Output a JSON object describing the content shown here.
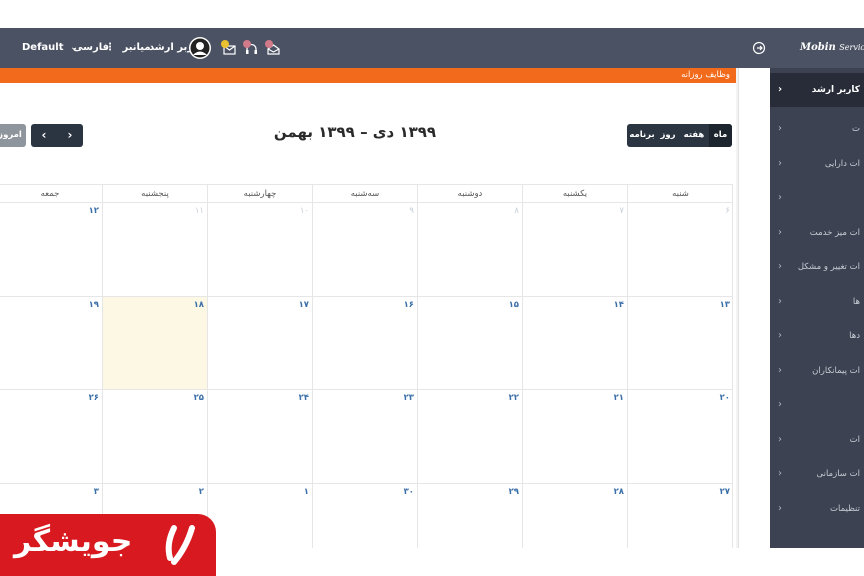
{
  "topbar": {
    "brand_main": "Mobin",
    "brand_sub": "Service De",
    "user_name": "کاربر ارشد",
    "shortcuts": "میانبر",
    "language": "فارسی",
    "theme": "Default"
  },
  "sidebar": {
    "active": {
      "label": "کاربر ارشد"
    },
    "items": [
      {
        "label": "ت"
      },
      {
        "label": "ات دارایی"
      },
      {
        "label": ""
      },
      {
        "label": "ات میز خدمت"
      },
      {
        "label": "ات تغییر و مشکل"
      },
      {
        "label": "ها"
      },
      {
        "label": "دها"
      },
      {
        "label": "ات پیمانکاران"
      },
      {
        "label": ""
      },
      {
        "label": "ات"
      },
      {
        "label": "ات سازمانی"
      },
      {
        "label": "تنظیمات"
      }
    ]
  },
  "content": {
    "section_title": "وظایف روزانه",
    "calendar_title": "۱۳۹۹ دی – ۱۳۹۹ بهمن",
    "views": [
      "ماه",
      "هفته",
      "روز",
      "برنامه"
    ],
    "active_view": "ماه",
    "nav_prev": "‹",
    "nav_next": "›",
    "today_label": "امروز",
    "weekdays": [
      "شنبه",
      "یکشنبه",
      "دوشنبه",
      "سه‌شنبه",
      "چهارشنبه",
      "پنجشنبه",
      "جمعه"
    ],
    "weeks": [
      [
        {
          "d": "۶",
          "other": true
        },
        {
          "d": "۷",
          "other": true
        },
        {
          "d": "۸",
          "other": true
        },
        {
          "d": "۹",
          "other": true
        },
        {
          "d": "۱۰",
          "other": true
        },
        {
          "d": "۱۱",
          "other": true
        },
        {
          "d": "۱۲"
        }
      ],
      [
        {
          "d": "۱۳"
        },
        {
          "d": "۱۴"
        },
        {
          "d": "۱۵"
        },
        {
          "d": "۱۶"
        },
        {
          "d": "۱۷"
        },
        {
          "d": "۱۸",
          "today": true
        },
        {
          "d": "۱۹"
        }
      ],
      [
        {
          "d": "۲۰"
        },
        {
          "d": "۲۱"
        },
        {
          "d": "۲۲"
        },
        {
          "d": "۲۳"
        },
        {
          "d": "۲۴"
        },
        {
          "d": "۲۵"
        },
        {
          "d": "۲۶"
        }
      ],
      [
        {
          "d": "۲۷"
        },
        {
          "d": "۲۸"
        },
        {
          "d": "۲۹"
        },
        {
          "d": "۳۰"
        },
        {
          "d": "۱"
        },
        {
          "d": "۲"
        },
        {
          "d": "۳"
        }
      ]
    ]
  },
  "watermark": {
    "text": "جویشگر"
  },
  "colors": {
    "topbar": "#4b5263",
    "sidebar": "#3c4252",
    "accent": "#f26a1b",
    "today": "#fcf8e3",
    "logo": "#d8191f"
  }
}
